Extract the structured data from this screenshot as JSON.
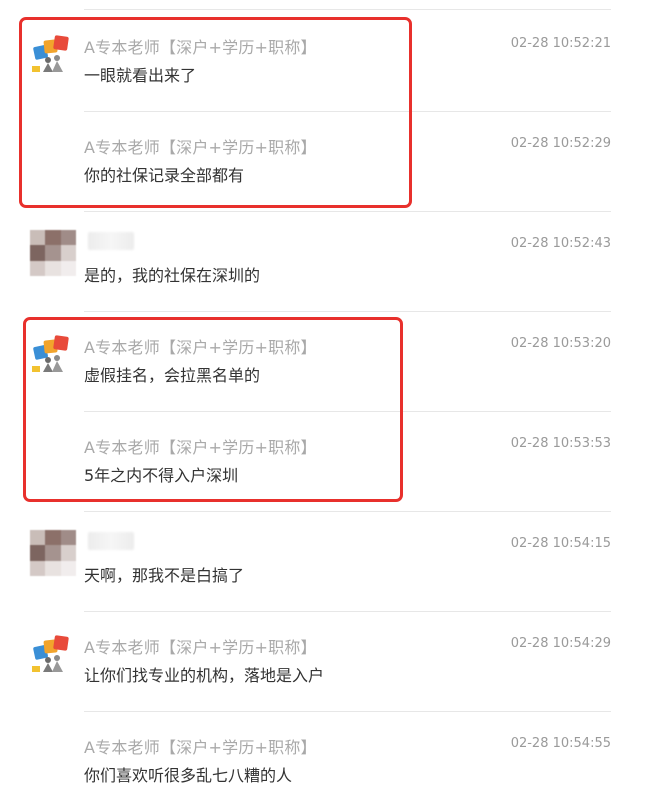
{
  "messages": [
    {
      "sender": "A专本老师【深户+学历+职称】",
      "time": "02-28 10:52:21",
      "text": "一眼就看出来了",
      "kind": "teacher",
      "show_avatar": true
    },
    {
      "sender": "A专本老师【深户+学历+职称】",
      "time": "02-28 10:52:29",
      "text": "你的社保记录全部都有",
      "kind": "teacher",
      "show_avatar": false
    },
    {
      "sender": "",
      "time": "02-28 10:52:43",
      "text": "是的，我的社保在深圳的",
      "kind": "user",
      "show_avatar": true
    },
    {
      "sender": "A专本老师【深户+学历+职称】",
      "time": "02-28 10:53:20",
      "text": "虚假挂名，会拉黑名单的",
      "kind": "teacher",
      "show_avatar": true
    },
    {
      "sender": "A专本老师【深户+学历+职称】",
      "time": "02-28 10:53:53",
      "text": "5年之内不得入户深圳",
      "kind": "teacher",
      "show_avatar": false
    },
    {
      "sender": "",
      "time": "02-28 10:54:15",
      "text": "天啊，那我不是白搞了",
      "kind": "user",
      "show_avatar": true
    },
    {
      "sender": "A专本老师【深户+学历+职称】",
      "time": "02-28 10:54:29",
      "text": "让你们找专业的机构，落地是入户",
      "kind": "teacher",
      "show_avatar": true
    },
    {
      "sender": "A专本老师【深户+学历+职称】",
      "time": "02-28 10:54:55",
      "text": "你们喜欢听很多乱七八糟的人",
      "kind": "teacher",
      "show_avatar": false
    }
  ],
  "avatar_logo_letters": "招",
  "colors": {
    "highlight": "#e8302c",
    "name": "#a9a9a9",
    "text": "#333333",
    "time": "#9a9a9a",
    "divider": "#e7e7e7"
  }
}
